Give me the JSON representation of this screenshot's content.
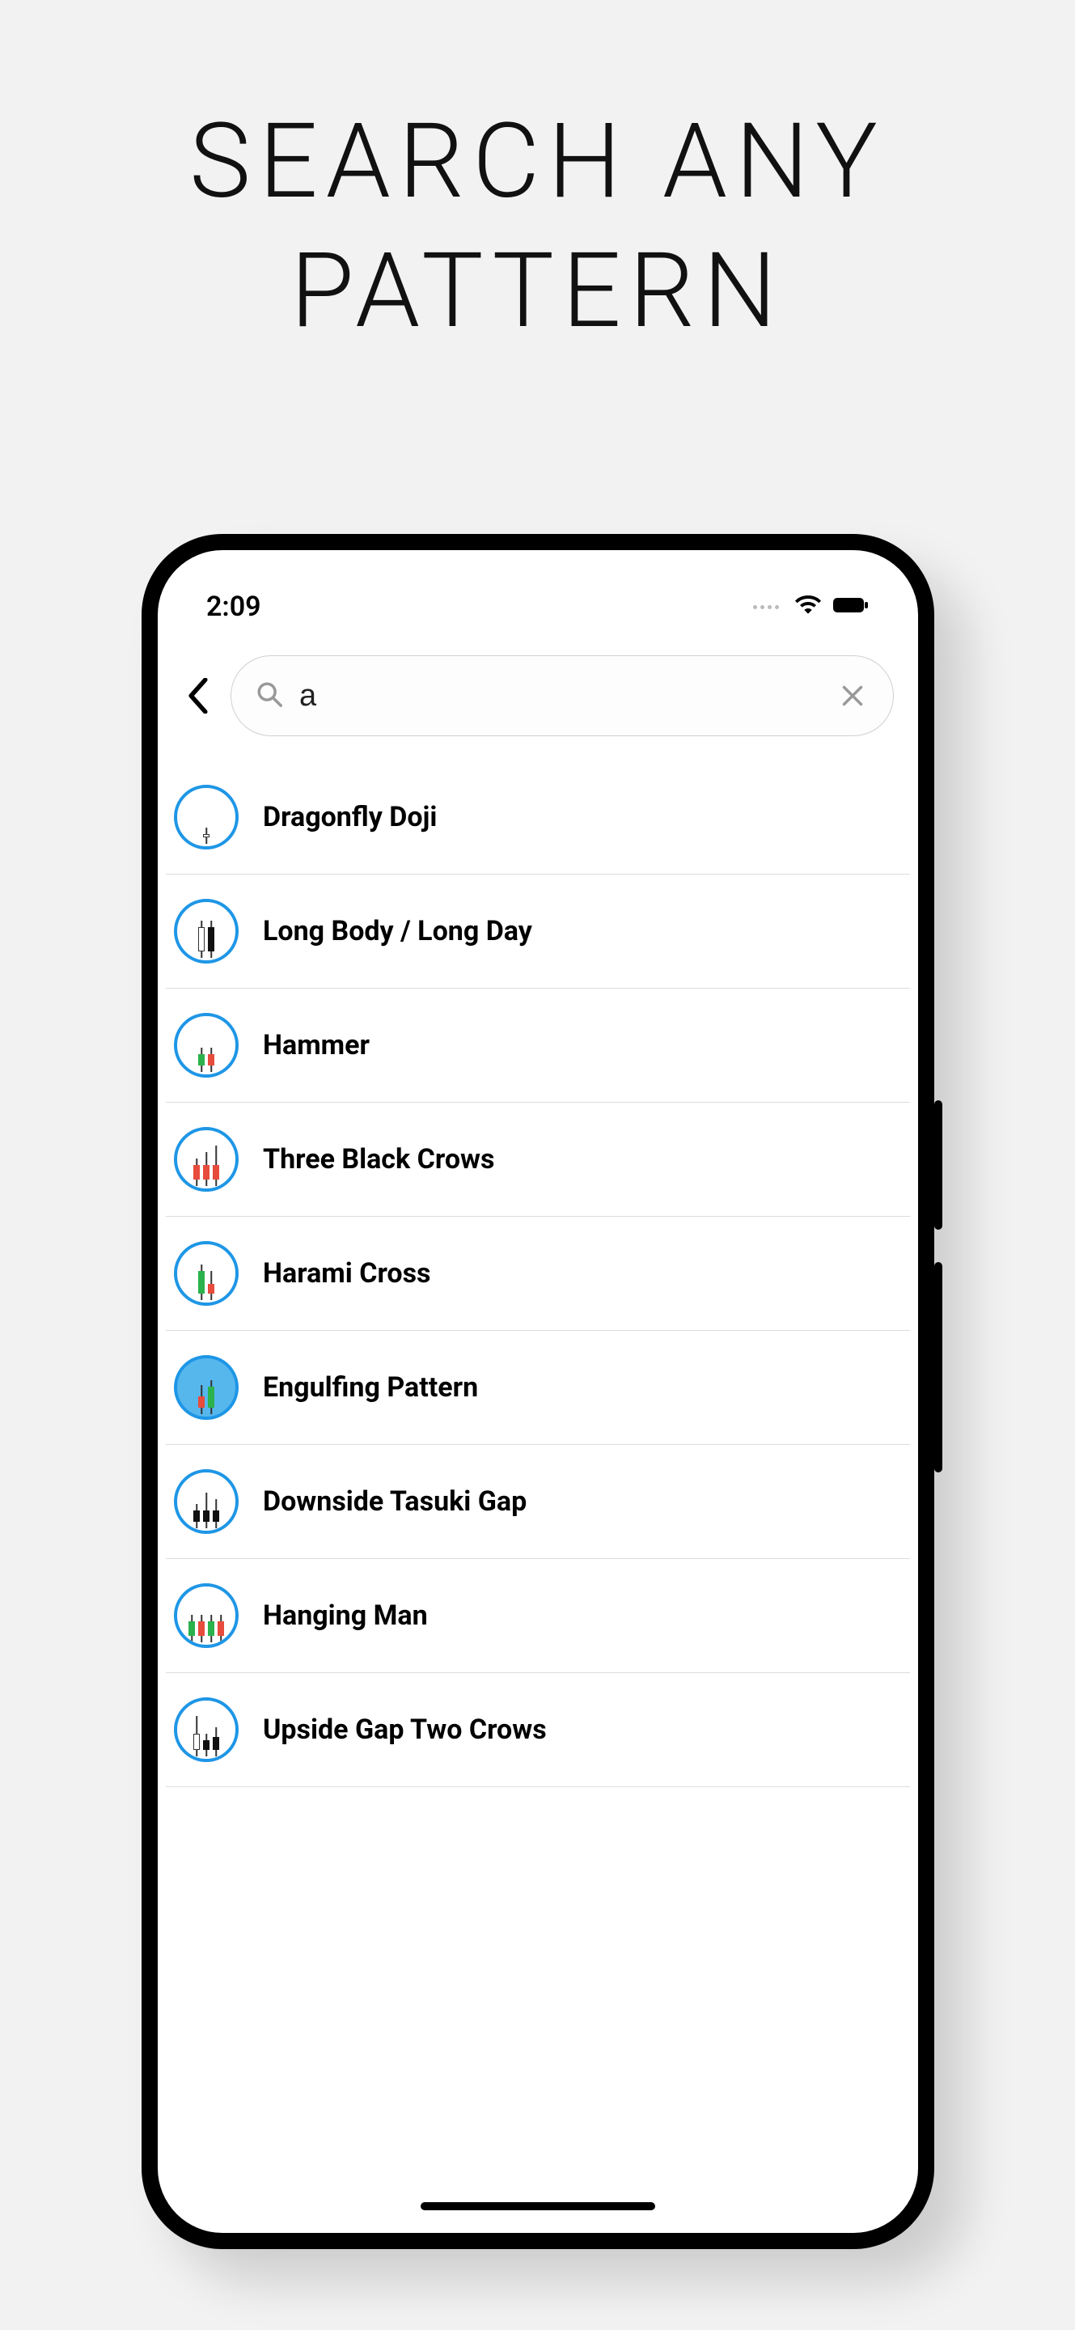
{
  "headline_line1": "SEARCH ANY",
  "headline_line2": "PATTERN",
  "status": {
    "time": "2:09"
  },
  "search": {
    "value": "a"
  },
  "results": [
    {
      "label": "Dragonfly Doji",
      "icon": "dragonfly-doji"
    },
    {
      "label": "Long Body / Long Day",
      "icon": "long-body"
    },
    {
      "label": "Hammer",
      "icon": "hammer"
    },
    {
      "label": "Three Black Crows",
      "icon": "three-black-crows"
    },
    {
      "label": "Harami Cross",
      "icon": "harami-cross"
    },
    {
      "label": "Engulfing Pattern",
      "icon": "engulfing",
      "filled": true
    },
    {
      "label": "Downside Tasuki Gap",
      "icon": "tasuki-gap"
    },
    {
      "label": "Hanging Man",
      "icon": "hanging-man"
    },
    {
      "label": "Upside Gap Two Crows",
      "icon": "upside-gap-two-crows"
    }
  ]
}
